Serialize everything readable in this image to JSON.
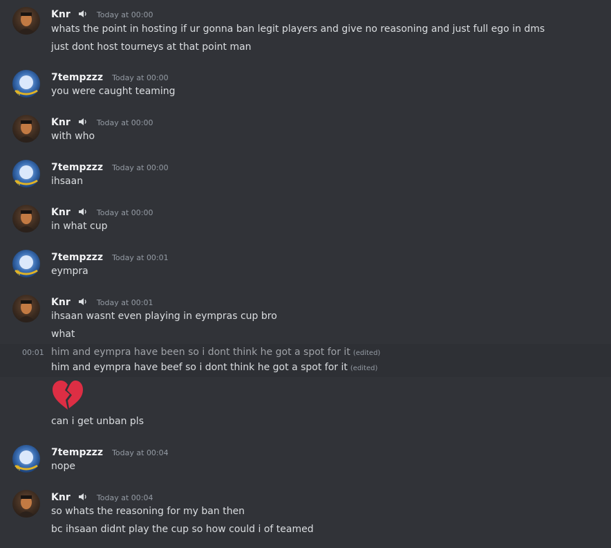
{
  "groups": [
    {
      "user": "Knr",
      "time": "Today at 00:00",
      "lines": [
        "whats the point in hosting if ur gonna ban legit players and give no reasoning and just full ego in dms",
        "just dont host tourneys at that point man"
      ]
    },
    {
      "user": "7tempzzz",
      "time": "Today at 00:00",
      "lines": [
        "you were caught teaming"
      ]
    },
    {
      "user": "Knr",
      "time": "Today at 00:00",
      "lines": [
        "with who"
      ]
    },
    {
      "user": "7tempzzz",
      "time": "Today at 00:00",
      "lines": [
        "ihsaan"
      ]
    },
    {
      "user": "Knr",
      "time": "Today at 00:00",
      "lines": [
        "in what cup"
      ]
    },
    {
      "user": "7tempzzz",
      "time": "Today at 00:01",
      "lines": [
        "eympra"
      ]
    },
    {
      "user": "Knr",
      "time": "Today at 00:01",
      "lines": [
        "ihsaan wasnt even playing in eympras cup bro",
        "what",
        "him and eympra have been so i dont think he got a spot for it",
        "him and eympra have beef so i dont think he got a spot for it",
        "can i get unban pls"
      ]
    },
    {
      "user": "7tempzzz",
      "time": "Today at 00:04",
      "lines": [
        "nope"
      ]
    },
    {
      "user": "Knr",
      "time": "Today at 00:04",
      "lines": [
        "so whats the reasoning for my ban then",
        "bc ihsaan didnt play the cup so how could i of teamed"
      ]
    }
  ],
  "hover_timestamp": "00:01",
  "edited_label": "(edited)",
  "emoji": "broken-heart",
  "colors": {
    "background": "#313338",
    "hover": "#2e3035",
    "username": "#f2f3f5",
    "text": "#dbdee1",
    "muted": "#949ba4",
    "heart": "#dd2e44"
  }
}
